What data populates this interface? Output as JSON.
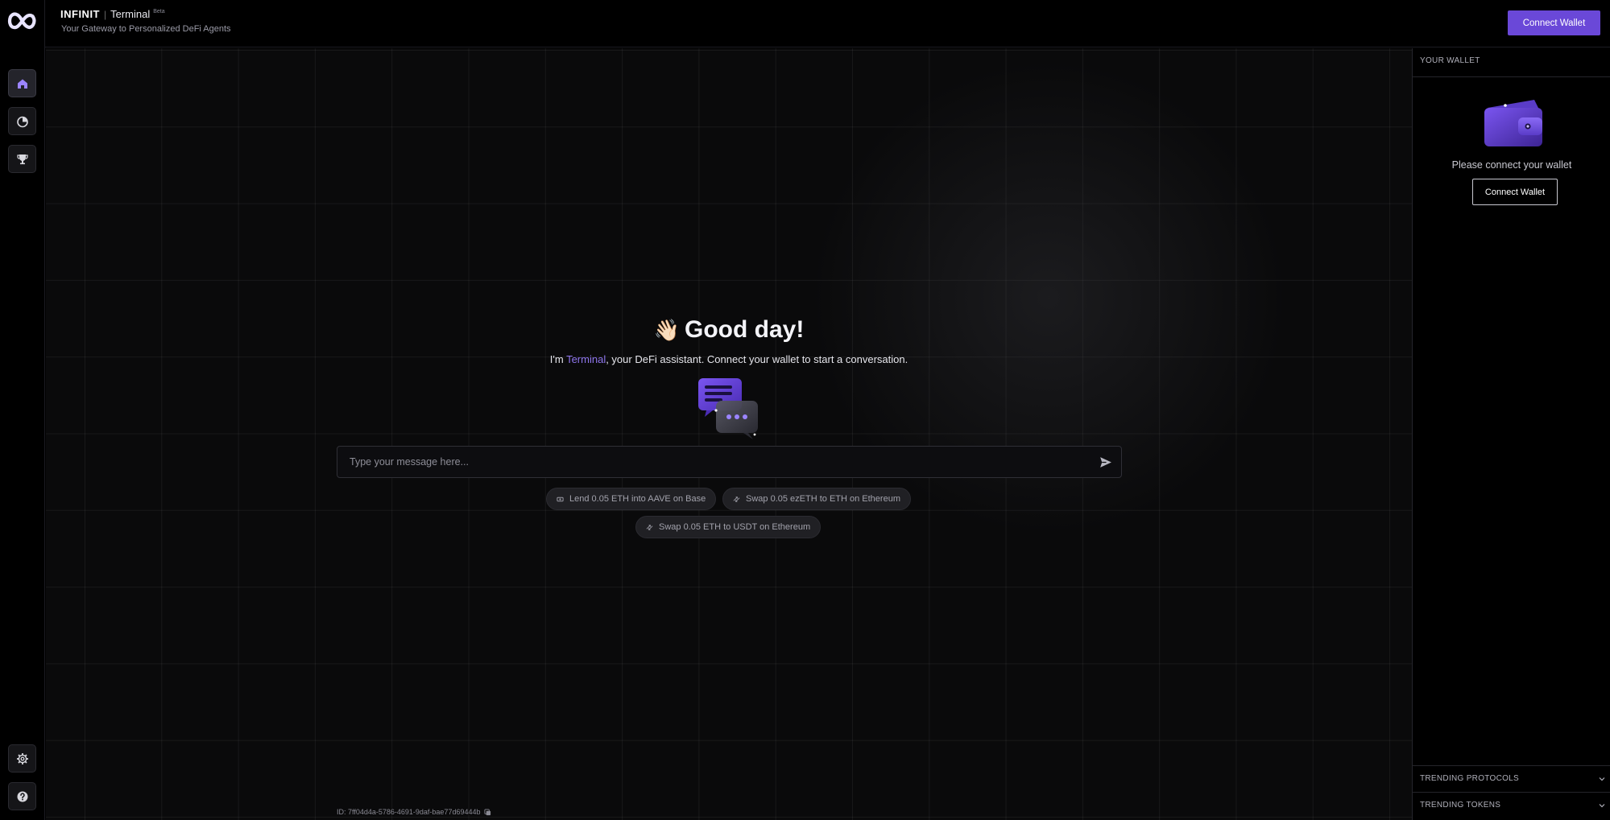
{
  "app": {
    "brand": "INFINIT",
    "product": "Terminal",
    "badge": "Beta",
    "tagline": "Your Gateway to Personalized DeFi Agents"
  },
  "header": {
    "connect_label": "Connect Wallet"
  },
  "nav": {
    "items": [
      {
        "icon": "home-icon",
        "active": true
      },
      {
        "icon": "pie-chart-icon",
        "active": false
      },
      {
        "icon": "trophy-icon",
        "active": false
      }
    ],
    "bottom": [
      {
        "icon": "gear-icon"
      },
      {
        "icon": "help-icon"
      }
    ]
  },
  "main": {
    "greeting_emoji": "👋🏻",
    "greeting": "Good day!",
    "intro_prefix": "I'm ",
    "intro_accent": "Terminal",
    "intro_suffix": ", your DeFi assistant. Connect your wallet to start a conversation.",
    "input_placeholder": "Type your message here...",
    "input_value": "",
    "suggestions": [
      {
        "icon": "lend-icon",
        "label": "Lend 0.05 ETH into AAVE on Base"
      },
      {
        "icon": "swap-icon",
        "label": "Swap 0.05 ezETH to ETH on Ethereum"
      },
      {
        "icon": "swap-icon",
        "label": "Swap 0.05 ETH to USDT on Ethereum"
      }
    ],
    "session_id": "ID: 7ff04d4a-5786-4691-9daf-bae77d69444b"
  },
  "wallet_panel": {
    "title": "YOUR WALLET",
    "message": "Please connect your wallet",
    "connect_label": "Connect Wallet",
    "sections": [
      "TRENDING PROTOCOLS",
      "TRENDING TOKENS"
    ]
  },
  "colors": {
    "accent": "#6a48d8",
    "accent_text": "#8f76ee",
    "background": "#000000"
  }
}
